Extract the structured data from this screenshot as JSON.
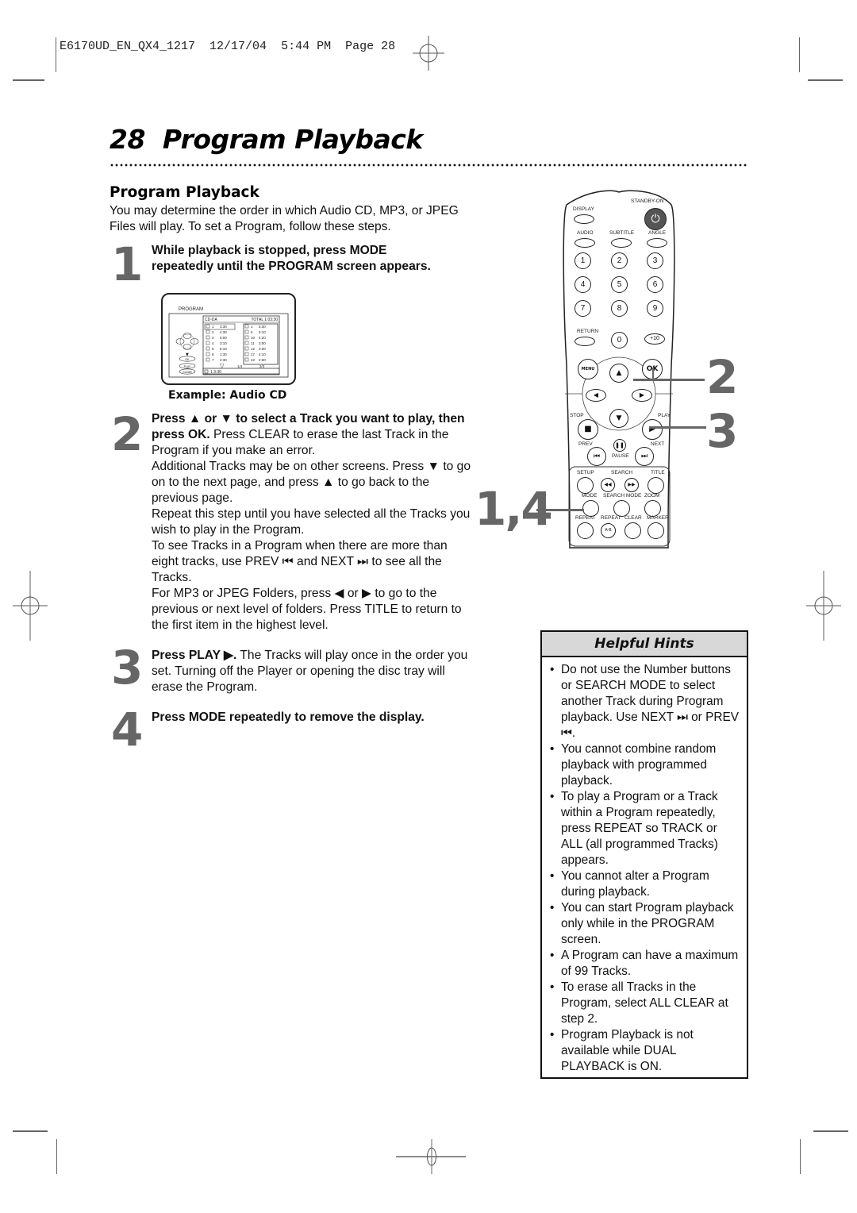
{
  "print_slug": {
    "file": "E6170UD_EN_QX4_1217",
    "date": "12/17/04",
    "time": "5:44 PM",
    "page_label": "Page 28"
  },
  "header": {
    "page_number": "28",
    "title": "Program Playback"
  },
  "section": {
    "title": "Program Playback",
    "intro": "You may determine the order in which Audio CD, MP3, or JPEG Files will play. To set a Program, follow these steps."
  },
  "steps": [
    {
      "number": "1",
      "bold": "While playback is stopped, press MODE repeatedly until the PROGRAM screen appears.",
      "text": ""
    },
    {
      "number": "2",
      "bold": "Press ▲ or ▼ to select a Track you want to play, then press OK.",
      "text": " Press CLEAR to erase the last Track in the Program if you make an error.",
      "paragraphs": [
        "Additional Tracks may be on other screens. Press ▼ to go on to the next page, and press ▲ to go back to the previous page.",
        "Repeat this step until you have selected all the Tracks you wish to play in the Program.",
        "To see Tracks in a Program when there are more than eight tracks, use PREV ⏮ and NEXT ⏭ to see all the Tracks.",
        "For MP3 or JPEG Folders, press ◀ or ▶ to go to the previous or next level of folders. Press TITLE to return to the first item in the highest level."
      ]
    },
    {
      "number": "3",
      "bold": "Press PLAY ▶.",
      "text": " The Tracks will play once in the order you set. Turning off the Player or opening the disc tray will erase the Program."
    },
    {
      "number": "4",
      "bold": "Press MODE repeatedly to remove the display.",
      "text": ""
    }
  ],
  "screen_example": {
    "caption": "Example: Audio CD",
    "title": "PROGRAM",
    "disc_type": "CD-DA",
    "total": "TOTAL 1:03:30",
    "left_tracks": [
      {
        "num": "1",
        "time": "3:30"
      },
      {
        "num": "2",
        "time": "4:30"
      },
      {
        "num": "3",
        "time": "5:00"
      },
      {
        "num": "4",
        "time": "3:10"
      },
      {
        "num": "5",
        "time": "5:10"
      },
      {
        "num": "6",
        "time": "1:30"
      },
      {
        "num": "7",
        "time": "2:30"
      }
    ],
    "left_page": "1/4",
    "right_tracks": [
      {
        "num": "1",
        "time": "3:30"
      },
      {
        "num": "5",
        "time": "5:10"
      },
      {
        "num": "10",
        "time": "4:20"
      },
      {
        "num": "11",
        "time": "3:00"
      },
      {
        "num": "12",
        "time": "3:20"
      },
      {
        "num": "17",
        "time": "4:10"
      },
      {
        "num": "22",
        "time": "2:50"
      }
    ],
    "right_page": "2/3",
    "selected": "1  3:30",
    "buttons": [
      "OK",
      "PLAY",
      "CLEAR"
    ]
  },
  "remote": {
    "labels": {
      "standby": "STANDBY-ON",
      "display": "DISPLAY",
      "audio": "AUDIO",
      "subtitle": "SUBTITLE",
      "angle": "ANGLE",
      "return": "RETURN",
      "menu": "MENU",
      "ok": "OK",
      "stop": "STOP",
      "play": "PLAY",
      "prev": "PREV",
      "pause": "PAUSE",
      "next": "NEXT",
      "setup": "SETUP",
      "search": "SEARCH",
      "title": "TITLE",
      "mode": "MODE",
      "search_mode": "SEARCH MODE",
      "zoom": "ZOOM",
      "repeat": "REPEAT",
      "repeat_ab": "REPEAT",
      "ab": "A-B",
      "clear": "CLEAR",
      "marker": "MARKER"
    },
    "digits": [
      "1",
      "2",
      "3",
      "4",
      "5",
      "6",
      "7",
      "8",
      "9",
      "0",
      "+10"
    ],
    "callouts": [
      "2",
      "3",
      "1,4"
    ]
  },
  "hints": {
    "title": "Helpful Hints",
    "items": [
      "Do not use the Number buttons or SEARCH MODE to select another Track during Program playback. Use NEXT ⏭ or PREV ⏮.",
      "You cannot combine random playback with programmed playback.",
      "To play a Program or a Track within a Program repeatedly, press REPEAT so TRACK or ALL (all programmed Tracks) appears.",
      "You cannot alter a Program during playback.",
      "You can start Program playback only while in the PROGRAM screen.",
      "A Program can have a maximum of 99 Tracks.",
      "To erase all Tracks in the Program, select ALL CLEAR at step 2.",
      "Program Playback is not available while DUAL PLAYBACK is ON."
    ]
  }
}
